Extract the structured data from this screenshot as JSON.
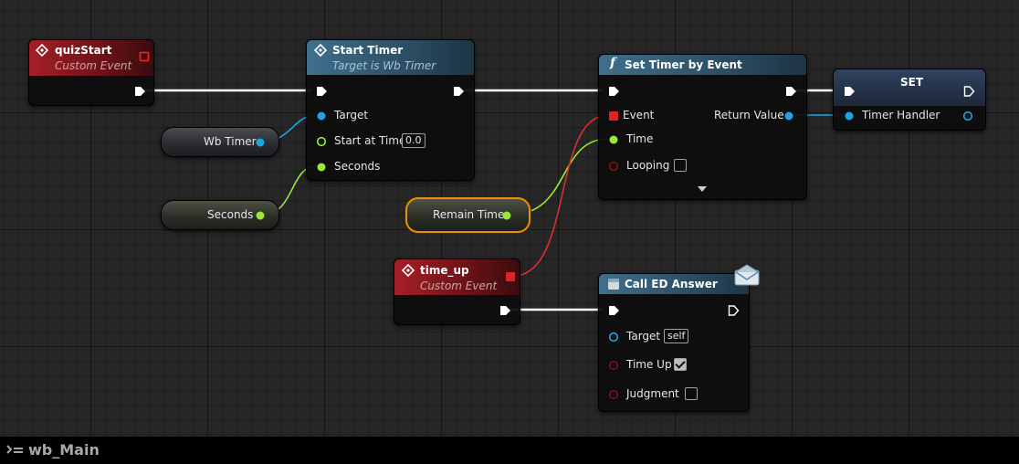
{
  "blueprint_title": "wb_Main",
  "nodes": {
    "quiz_start": {
      "title": "quizStart",
      "subtitle": "Custom Event"
    },
    "start_timer": {
      "title": "Start Timer",
      "subtitle": "Target is Wb Timer",
      "pins": {
        "target": "Target",
        "start_at_time": "Start at Time",
        "start_at_time_value": "0.0",
        "seconds": "Seconds"
      }
    },
    "set_timer": {
      "title": "Set Timer by Event",
      "pins": {
        "event": "Event",
        "time": "Time",
        "looping": "Looping",
        "return_value": "Return Value"
      },
      "looping_checked": false
    },
    "set_node": {
      "title": "SET",
      "pins": {
        "timer_handler": "Timer Handler"
      }
    },
    "time_up": {
      "title": "time_up",
      "subtitle": "Custom Event"
    },
    "call_ed": {
      "title": "Call ED Answer",
      "pins": {
        "target": "Target",
        "target_value": "self",
        "time_up": "Time Up",
        "judgment": "Judgment"
      },
      "time_up_checked": true,
      "judgment_checked": false
    }
  },
  "variables": {
    "wb_timer": "Wb Timer",
    "seconds": "Seconds",
    "remain_time": "Remain Time"
  },
  "colors": {
    "event_header": "#a51f26",
    "function_header": "#3f6f8d",
    "object_pin": "#1aa6e6",
    "float_pin": "#9be83a",
    "delegate_pin": "#e02424",
    "bool_pin": "#8a0f0f",
    "exec": "#ffffff",
    "selection": "#e8900e"
  }
}
